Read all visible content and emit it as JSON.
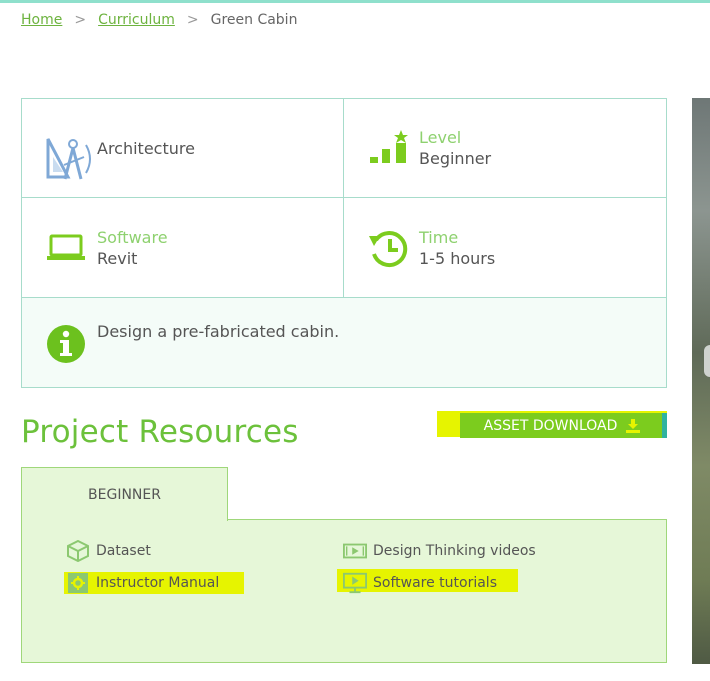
{
  "breadcrumb": {
    "home": "Home",
    "sep": ">",
    "curriculum": "Curriculum",
    "current": "Green Cabin"
  },
  "info": {
    "discipline": "Architecture",
    "level_label": "Level",
    "level_value": "Beginner",
    "software_label": "Software",
    "software_value": "Revit",
    "time_label": "Time",
    "time_value": "1-5 hours",
    "description": "Design a pre-fabricated cabin."
  },
  "resources": {
    "title": "Project Resources",
    "download_label": "ASSET DOWNLOAD",
    "tab_label": "BEGINNER",
    "items": [
      {
        "label": "Dataset",
        "icon": "cube-icon",
        "highlighted": false
      },
      {
        "label": "Design Thinking videos",
        "icon": "video-icon",
        "highlighted": false
      },
      {
        "label": "Instructor Manual",
        "icon": "gear-book-icon",
        "highlighted": true
      },
      {
        "label": "Software tutorials",
        "icon": "monitor-play-icon",
        "highlighted": true
      }
    ]
  },
  "colors": {
    "accent": "#6cc13b",
    "label": "#8ed16f",
    "button": "#7ccc1e",
    "highlight": "#e6f400",
    "border": "#a7dccb",
    "panel": "#e6f7d8"
  }
}
